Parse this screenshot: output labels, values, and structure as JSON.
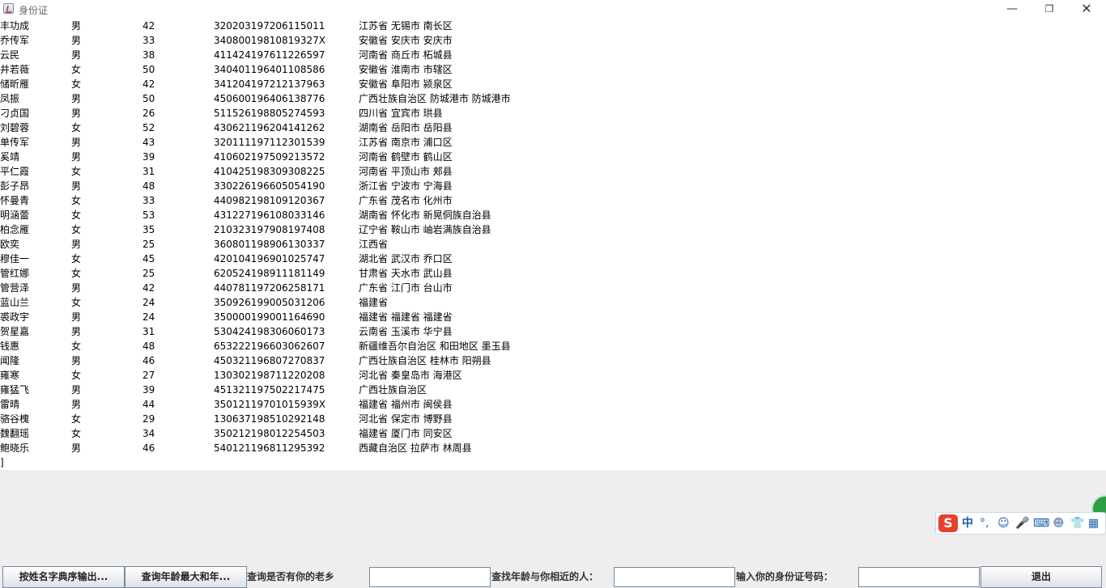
{
  "window": {
    "title": "身份证",
    "min_glyph": "—",
    "max_glyph": "❐",
    "close_glyph": "✕"
  },
  "records": [
    {
      "name": "丰功成",
      "sex": "男",
      "age": "42",
      "id": "320203197206115011",
      "addr": "江苏省 无锡市 南长区"
    },
    {
      "name": "乔传军",
      "sex": "男",
      "age": "33",
      "id": "34080019810819327X",
      "addr": "安徽省 安庆市 安庆市"
    },
    {
      "name": "云民",
      "sex": "男",
      "age": "38",
      "id": "411424197611226597",
      "addr": "河南省 商丘市 柘城县"
    },
    {
      "name": "井若薇",
      "sex": "女",
      "age": "50",
      "id": "340401196401108586",
      "addr": "安徽省 淮南市 市辖区"
    },
    {
      "name": "储昕雁",
      "sex": "女",
      "age": "42",
      "id": "341204197212137963",
      "addr": "安徽省 阜阳市 颍泉区"
    },
    {
      "name": "凤振",
      "sex": "男",
      "age": "50",
      "id": "450600196406138776",
      "addr": "广西壮族自治区 防城港市 防城港市"
    },
    {
      "name": "刁贞国",
      "sex": "男",
      "age": "26",
      "id": "511526198805274593",
      "addr": "四川省 宜宾市 珙县"
    },
    {
      "name": "刘碧蓉",
      "sex": "女",
      "age": "52",
      "id": "430621196204141262",
      "addr": "湖南省 岳阳市 岳阳县"
    },
    {
      "name": "单传军",
      "sex": "男",
      "age": "43",
      "id": "320111197112301539",
      "addr": "江苏省 南京市 浦口区"
    },
    {
      "name": "奚靖",
      "sex": "男",
      "age": "39",
      "id": "410602197509213572",
      "addr": "河南省 鹤壁市 鹤山区"
    },
    {
      "name": "平仁霞",
      "sex": "女",
      "age": "31",
      "id": "410425198309308225",
      "addr": "河南省 平顶山市 郏县"
    },
    {
      "name": "彭子昂",
      "sex": "男",
      "age": "48",
      "id": "330226196605054190",
      "addr": "浙江省 宁波市 宁海县"
    },
    {
      "name": "怀曼青",
      "sex": "女",
      "age": "33",
      "id": "440982198109120367",
      "addr": "广东省 茂名市 化州市"
    },
    {
      "name": "明涵蕾",
      "sex": "女",
      "age": "53",
      "id": "431227196108033146",
      "addr": "湖南省 怀化市 新晃侗族自治县"
    },
    {
      "name": "柏念雁",
      "sex": "女",
      "age": "35",
      "id": "210323197908197408",
      "addr": "辽宁省 鞍山市 岫岩满族自治县"
    },
    {
      "name": "欧奕",
      "sex": "男",
      "age": "25",
      "id": "360801198906130337",
      "addr": "江西省"
    },
    {
      "name": "穆佳一",
      "sex": "女",
      "age": "45",
      "id": "420104196901025747",
      "addr": "湖北省 武汉市 乔口区"
    },
    {
      "name": "管红娜",
      "sex": "女",
      "age": "25",
      "id": "620524198911181149",
      "addr": "甘肃省 天水市 武山县"
    },
    {
      "name": "管营泽",
      "sex": "男",
      "age": "42",
      "id": "440781197206258171",
      "addr": "广东省 江门市 台山市"
    },
    {
      "name": "蓝山兰",
      "sex": "女",
      "age": "24",
      "id": "350926199005031206",
      "addr": "福建省"
    },
    {
      "name": "裘政宇",
      "sex": "男",
      "age": "24",
      "id": "350000199001164690",
      "addr": "福建省 福建省 福建省"
    },
    {
      "name": "贺星嘉",
      "sex": "男",
      "age": "31",
      "id": "530424198306060173",
      "addr": "云南省 玉溪市 华宁县"
    },
    {
      "name": "钱惠",
      "sex": "女",
      "age": "48",
      "id": "653222196603062607",
      "addr": "新疆维吾尔自治区 和田地区 墨玉县"
    },
    {
      "name": "闻隆",
      "sex": "男",
      "age": "46",
      "id": "450321196807270837",
      "addr": "广西壮族自治区 桂林市 阳朔县"
    },
    {
      "name": "雍寒",
      "sex": "女",
      "age": "27",
      "id": "130302198711220208",
      "addr": "河北省 秦皇岛市 海港区"
    },
    {
      "name": "雍猛飞",
      "sex": "男",
      "age": "39",
      "id": "451321197502217475",
      "addr": "广西壮族自治区"
    },
    {
      "name": "雷晴",
      "sex": "男",
      "age": "44",
      "id": "35012119701015939X",
      "addr": "福建省 福州市 闽侯县"
    },
    {
      "name": "骆谷槐",
      "sex": "女",
      "age": "29",
      "id": "130637198510292148",
      "addr": "河北省 保定市 博野县"
    },
    {
      "name": "魏翻瑶",
      "sex": "女",
      "age": "34",
      "id": "350212198012254503",
      "addr": "福建省 厦门市 同安区"
    },
    {
      "name": "鲍晓乐",
      "sex": "男",
      "age": "46",
      "id": "540121196811295392",
      "addr": "西藏自治区 拉萨市 林周县"
    }
  ],
  "output_tail": "]",
  "controls": {
    "sort_button": "按姓名字典序输出...",
    "max_age_button": "查询年龄最大和年...",
    "hometown_label": "查询是否有你的老乡",
    "similar_age_label": "查找年龄与你相近的人：",
    "id_label": "输入你的身份证号码：",
    "exit_button": "退出"
  },
  "ime": {
    "logo": "S",
    "mode": "中",
    "punct": "°,",
    "emoji_icon": "smile-icon",
    "mic_icon": "microphone-icon",
    "keyboard_icon": "keyboard-icon",
    "user_icon": "user-icon",
    "skin_icon": "shirt-icon",
    "grid_icon": "grid-icon",
    "emoji_glyph": "☺",
    "mic_glyph": "🎤",
    "keyboard_glyph": "⌨",
    "user_glyph": "☻",
    "skin_glyph": "👕",
    "grid_glyph": "▦"
  }
}
